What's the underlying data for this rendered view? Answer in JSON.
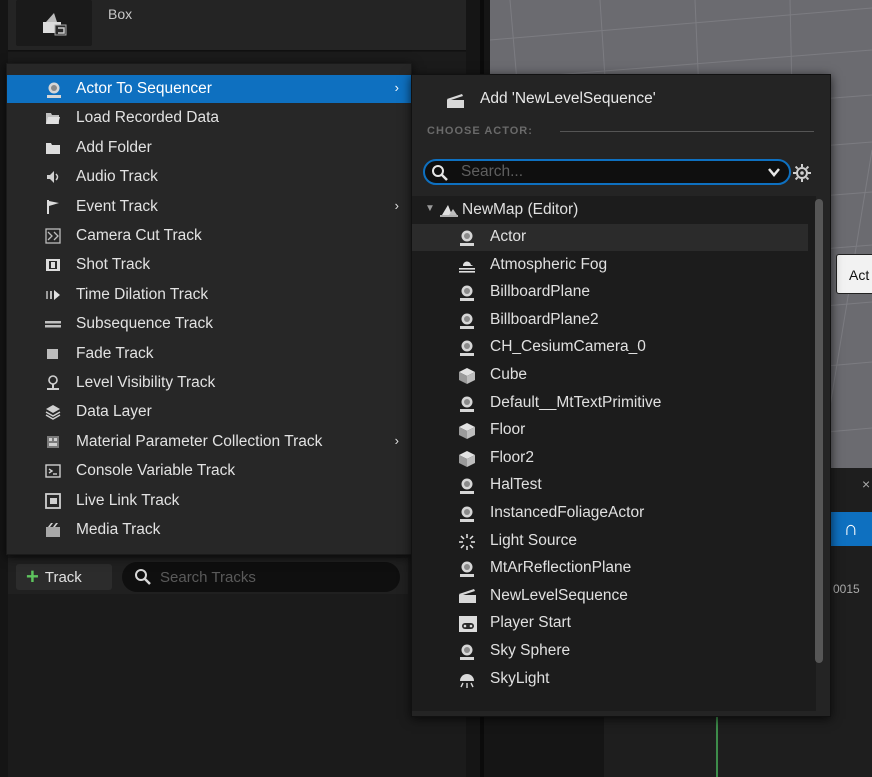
{
  "background": {
    "top_item_label": "Box",
    "viewport_actor_label": "Act",
    "timeline_frame": "0015",
    "close_glyph": "×",
    "magnet_glyph": "∩"
  },
  "track_bar": {
    "add_track_label": "Track",
    "search_placeholder": "Search Tracks"
  },
  "menu": {
    "items": [
      {
        "label": "Actor To Sequencer",
        "icon": "actor-icon",
        "submenu": true,
        "selected": true
      },
      {
        "label": "Load Recorded Data",
        "icon": "folder-open-icon"
      },
      {
        "label": "Add Folder",
        "icon": "folder-icon"
      },
      {
        "label": "Audio Track",
        "icon": "speaker-icon"
      },
      {
        "label": "Event Track",
        "icon": "flag-icon",
        "submenu": true
      },
      {
        "label": "Camera Cut Track",
        "icon": "camera-cut-icon"
      },
      {
        "label": "Shot Track",
        "icon": "film-icon"
      },
      {
        "label": "Time Dilation Track",
        "icon": "time-dilation-icon"
      },
      {
        "label": "Subsequence Track",
        "icon": "subsequence-icon"
      },
      {
        "label": "Fade Track",
        "icon": "fade-icon"
      },
      {
        "label": "Level Visibility Track",
        "icon": "level-visibility-icon"
      },
      {
        "label": "Data Layer",
        "icon": "layers-icon"
      },
      {
        "label": "Material Parameter Collection Track",
        "icon": "material-icon",
        "submenu": true
      },
      {
        "label": "Console Variable Track",
        "icon": "console-icon"
      },
      {
        "label": "Live Link Track",
        "icon": "live-link-icon"
      },
      {
        "label": "Media Track",
        "icon": "media-icon"
      }
    ],
    "submenu_arrow": "›"
  },
  "actor_menu": {
    "add_label": "Add 'NewLevelSequence'",
    "section_label": "CHOOSE ACTOR:",
    "search_placeholder": "Search...",
    "root_label": "NewMap (Editor)",
    "actors": [
      {
        "label": "Actor",
        "icon": "actor-icon"
      },
      {
        "label": "Atmospheric Fog",
        "icon": "fog-icon"
      },
      {
        "label": "BillboardPlane",
        "icon": "actor-icon"
      },
      {
        "label": "BillboardPlane2",
        "icon": "actor-icon"
      },
      {
        "label": "CH_CesiumCamera_0",
        "icon": "actor-icon"
      },
      {
        "label": "Cube",
        "icon": "static-mesh-icon"
      },
      {
        "label": "Default__MtTextPrimitive",
        "icon": "actor-icon"
      },
      {
        "label": "Floor",
        "icon": "static-mesh-icon"
      },
      {
        "label": "Floor2",
        "icon": "static-mesh-icon"
      },
      {
        "label": "HalTest",
        "icon": "actor-icon"
      },
      {
        "label": "InstancedFoliageActor",
        "icon": "actor-icon"
      },
      {
        "label": "Light Source",
        "icon": "light-source-icon"
      },
      {
        "label": "MtArReflectionPlane",
        "icon": "actor-icon"
      },
      {
        "label": "NewLevelSequence",
        "icon": "clapperboard-icon"
      },
      {
        "label": "Player Start",
        "icon": "player-start-icon"
      },
      {
        "label": "Sky Sphere",
        "icon": "actor-icon"
      },
      {
        "label": "SkyLight",
        "icon": "skylight-icon"
      }
    ]
  },
  "colors": {
    "accent": "#0e70c0",
    "menu_bg": "#272727",
    "submenu_bg": "#242424",
    "add_green": "#5ec45e"
  }
}
